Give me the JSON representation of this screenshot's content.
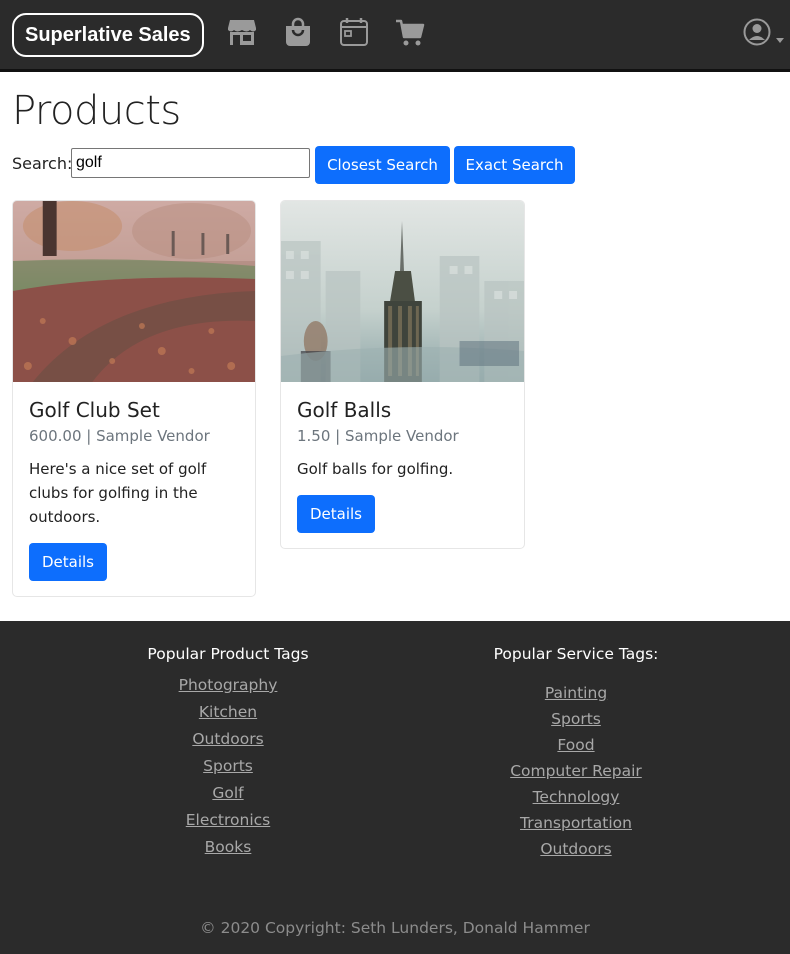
{
  "navbar": {
    "brand": "Superlative Sales",
    "icons": [
      "store-icon",
      "shopping-bag-icon",
      "calendar-icon",
      "cart-icon",
      "user-circle-icon"
    ]
  },
  "main": {
    "title": "Products",
    "search": {
      "label": "Search:",
      "value": "golf",
      "closest_label": "Closest Search",
      "exact_label": "Exact Search"
    },
    "products": [
      {
        "title": "Golf Club Set",
        "subtitle": "600.00 | Sample Vendor",
        "description": "Here's a nice set of golf clubs for golfing in the outdoors.",
        "button": "Details"
      },
      {
        "title": "Golf Balls",
        "subtitle": "1.50 | Sample Vendor",
        "description": "Golf balls for golfing.",
        "button": "Details"
      }
    ]
  },
  "footer": {
    "product_heading": "Popular Product Tags",
    "product_tags": [
      "Photography",
      "Kitchen",
      "Outdoors",
      "Sports",
      "Golf",
      "Electronics",
      "Books"
    ],
    "service_heading": "Popular Service Tags:",
    "service_tags": [
      "Painting",
      "Sports",
      "Food",
      "Computer Repair",
      "Technology",
      "Transportation",
      "Outdoors"
    ],
    "copyright": "© 2020 Copyright: Seth Lunders, Donald Hammer"
  },
  "colors": {
    "navbar_bg": "#2b2b2b",
    "primary": "#0d6efd",
    "muted": "#6c757d",
    "footer_link": "#a8a8a8"
  }
}
